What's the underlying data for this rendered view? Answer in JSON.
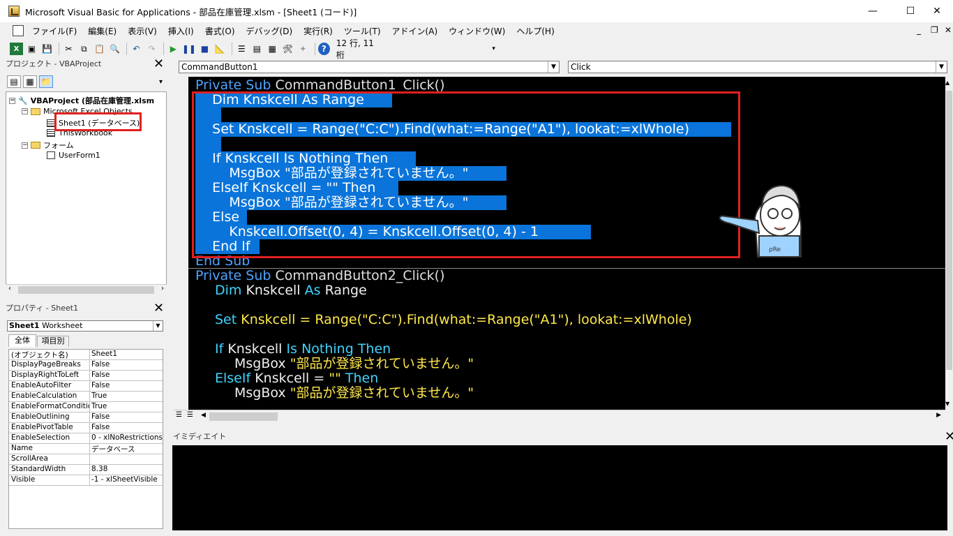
{
  "window": {
    "title": "Microsoft Visual Basic for Applications - 部品在庫管理.xlsm - [Sheet1 (コード)]",
    "minimize": "—",
    "maximize": "☐",
    "close": "✕"
  },
  "menu": [
    "ファイル(F)",
    "編集(E)",
    "表示(V)",
    "挿入(I)",
    "書式(O)",
    "デバッグ(D)",
    "実行(R)",
    "ツール(T)",
    "アドイン(A)",
    "ウィンドウ(W)",
    "ヘルプ(H)"
  ],
  "toolbar": {
    "position": "12 行, 11 桁"
  },
  "project": {
    "header": "プロジェクト - VBAProject",
    "root": "VBAProject (部品在庫管理.xlsm",
    "excel_objects": "Microsoft Excel Objects",
    "sheet1": "Sheet1 (データベース)",
    "thisworkbook": "ThisWorkbook",
    "forms": "フォーム",
    "userform": "UserForm1"
  },
  "props": {
    "header": "プロパティ - Sheet1",
    "object_name": "Sheet1",
    "object_type": "Worksheet",
    "tab_all": "全体",
    "tab_category": "項目別",
    "rows": [
      {
        "name": "(オブジェクト名)",
        "value": "Sheet1"
      },
      {
        "name": "DisplayPageBreaks",
        "value": "False"
      },
      {
        "name": "DisplayRightToLeft",
        "value": "False"
      },
      {
        "name": "EnableAutoFilter",
        "value": "False"
      },
      {
        "name": "EnableCalculation",
        "value": "True"
      },
      {
        "name": "EnableFormatConditions",
        "value": "True"
      },
      {
        "name": "EnableOutlining",
        "value": "False"
      },
      {
        "name": "EnablePivotTable",
        "value": "False"
      },
      {
        "name": "EnableSelection",
        "value": "0 - xlNoRestrictions"
      },
      {
        "name": "Name",
        "value": "データベース"
      },
      {
        "name": "ScrollArea",
        "value": ""
      },
      {
        "name": "StandardWidth",
        "value": "8.38"
      },
      {
        "name": "Visible",
        "value": "-1 - xlSheetVisible"
      }
    ]
  },
  "code": {
    "object_combo": "CommandButton1",
    "proc_combo": "Click",
    "sub1": {
      "private": "Private",
      "sub": "Sub",
      "name": "CommandButton1_Click()",
      "l1": "    Dim Knskcell As Range",
      "l2": "    Set Knskcell = Range(\"C:C\").Find(what:=Range(\"A1\"), lookat:=xlWhole)",
      "l3": "    If Knskcell Is Nothing Then",
      "l4": "        MsgBox \"部品が登録されていません。\"",
      "l5": "    ElseIf Knskcell = \"\" Then",
      "l6": "        MsgBox \"部品が登録されていません。\"",
      "l7": "    Else",
      "l8": "        Knskcell.Offset(0, 4) = Knskcell.Offset(0, 4) - 1",
      "l9": "    End If",
      "end": "End Sub"
    },
    "sub2": {
      "private": "Private",
      "sub": "Sub",
      "name": "CommandButton2_Click()",
      "dim": "Dim",
      "var": "Knskcell",
      "as": "As",
      "range": "Range",
      "set": "Set",
      "set_rest": "Knskcell = Range(\"C:C\").Find(what:=Range(\"A1\"), lookat:=xlWhole)",
      "if": "If",
      "is": "Is",
      "nothing_then": "Nothing Then",
      "msgbox": "MsgBox",
      "msg": "\"部品が登録されていません。\"",
      "elseif": "ElseIf",
      "elseif_mid": "Knskcell = ",
      "empty": "\"\"",
      "then": "Then"
    }
  },
  "immediate": {
    "header": "イミディエイト"
  },
  "colors": {
    "selection": "#0a74da",
    "highlight_box": "#e02020",
    "keyword": "#3fd4ff",
    "string": "#ffe84a"
  }
}
